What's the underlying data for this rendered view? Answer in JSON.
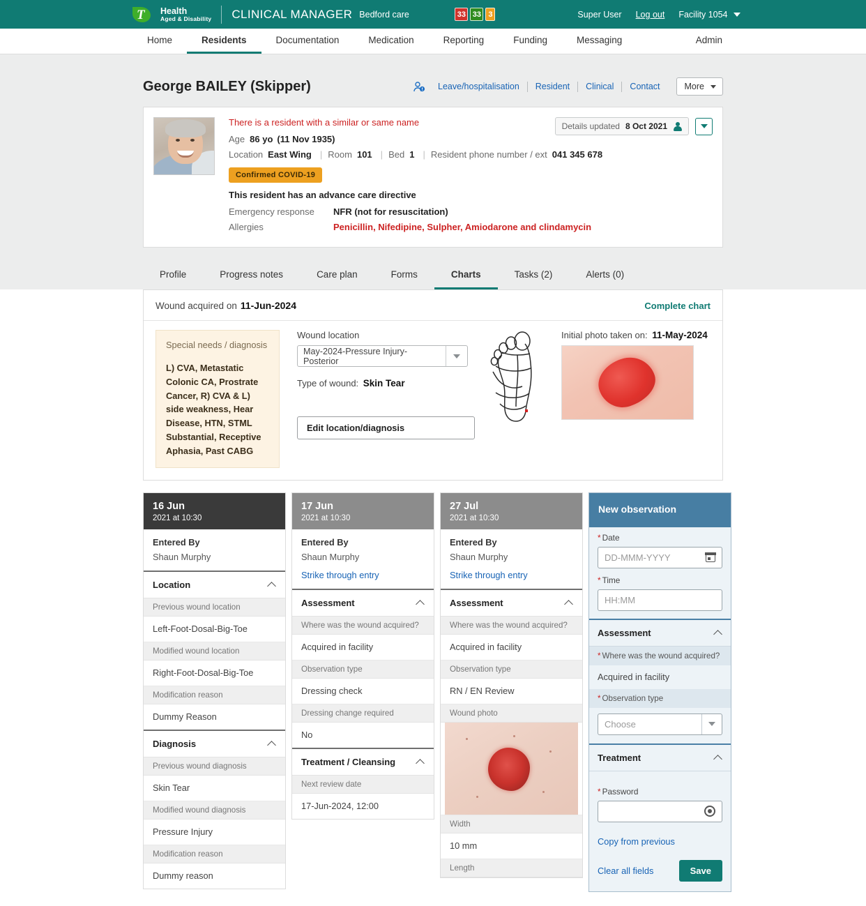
{
  "topbar": {
    "brand_line1": "Health",
    "brand_line2": "Aged & Disability",
    "app_title": "CLINICAL MANAGER",
    "facility_name": "Bedford care",
    "badges": [
      {
        "value": "33",
        "color": "#d0342c",
        "name": "alerts-red"
      },
      {
        "value": "33",
        "color": "#2f8c1f",
        "name": "alerts-green"
      },
      {
        "value": "3",
        "color": "#eda020",
        "name": "alerts-orange"
      }
    ],
    "user": "Super User",
    "logout": "Log out",
    "facility_selector": "Facility 1054"
  },
  "nav": {
    "items": [
      "Home",
      "Residents",
      "Documentation",
      "Medication",
      "Reporting",
      "Funding",
      "Messaging"
    ],
    "active": "Residents",
    "admin": "Admin"
  },
  "resident": {
    "name": "George BAILEY (Skipper)",
    "actions": [
      "Leave/hospitalisation",
      "Resident",
      "Clinical",
      "Contact"
    ],
    "more_label": "More",
    "similar_name_warning": "There is a resident with a similar or same name",
    "age_label": "Age",
    "age_value": "86 yo",
    "dob": "(11 Nov 1935)",
    "location_label": "Location",
    "location_value": "East Wing",
    "room_label": "Room",
    "room_value": "101",
    "bed_label": "Bed",
    "bed_value": "1",
    "phone_label": "Resident phone number / ext",
    "phone_value": "041 345 678",
    "covid_tag": "Confirmed COVID-19",
    "advance_care": "This resident has an advance care directive",
    "emergency_label": "Emergency response",
    "emergency_value": "NFR (not for resuscitation)",
    "allergies_label": "Allergies",
    "allergies_value": "Penicillin, Nifedipine, Sulpher, Amiodarone and clindamycin",
    "updated_label": "Details updated",
    "updated_date": "8 Oct 2021"
  },
  "subtabs": {
    "items": [
      "Profile",
      "Progress notes",
      "Care plan",
      "Forms",
      "Charts",
      "Tasks (2)",
      "Alerts (0)"
    ],
    "active": "Charts"
  },
  "wound": {
    "acquired_label": "Wound acquired on",
    "acquired_date": "11-Jun-2024",
    "complete_chart": "Complete chart",
    "special_needs_label": "Special needs / diagnosis",
    "special_needs_value": "L) CVA, Metastatic Colonic CA, Prostrate Cancer, R) CVA & L) side weakness, Hear Disease, HTN, STML Substantial, Receptive Aphasia, Past CABG",
    "location_label": "Wound location",
    "location_value": "May-2024-Pressure Injury-Posterior",
    "type_label": "Type of wound:",
    "type_value": "Skin Tear",
    "edit_button": "Edit location/diagnosis",
    "initial_photo_label": "Initial photo taken on:",
    "initial_photo_date": "11-May-2024"
  },
  "observations": [
    {
      "date": "16 Jun",
      "time": "2021 at 10:30",
      "header_style": "dark",
      "entered_by_label": "Entered By",
      "entered_by_value": "Shaun Murphy",
      "strike_link": null,
      "sections": [
        {
          "title": "Location",
          "fields": [
            {
              "key": "Previous wound location",
              "value": "Left-Foot-Dosal-Big-Toe"
            },
            {
              "key": "Modified wound location",
              "value": "Right-Foot-Dosal-Big-Toe"
            },
            {
              "key": "Modification reason",
              "value": "Dummy Reason"
            }
          ]
        },
        {
          "title": "Diagnosis",
          "fields": [
            {
              "key": "Previous wound diagnosis",
              "value": "Skin Tear"
            },
            {
              "key": "Modified wound diagnosis",
              "value": "Pressure Injury"
            },
            {
              "key": "Modification reason",
              "value": "Dummy reason"
            }
          ]
        }
      ]
    },
    {
      "date": "17 Jun",
      "time": "2021 at 10:30",
      "header_style": "grey",
      "entered_by_label": "Entered By",
      "entered_by_value": "Shaun Murphy",
      "strike_link": "Strike through entry",
      "sections": [
        {
          "title": "Assessment",
          "fields": [
            {
              "key": "Where was the wound acquired?",
              "value": "Acquired in facility"
            },
            {
              "key": "Observation type",
              "value": "Dressing check"
            },
            {
              "key": "Dressing change required",
              "value": "No"
            }
          ]
        },
        {
          "title": "Treatment / Cleansing",
          "fields": [
            {
              "key": "Next review date",
              "value": "17-Jun-2024, 12:00"
            }
          ]
        }
      ]
    },
    {
      "date": "27 Jul",
      "time": "2021 at 10:30",
      "header_style": "grey",
      "entered_by_label": "Entered By",
      "entered_by_value": "Shaun Murphy",
      "strike_link": "Strike through entry",
      "sections": [
        {
          "title": "Assessment",
          "fields": [
            {
              "key": "Where was the wound acquired?",
              "value": "Acquired in facility"
            },
            {
              "key": "Observation type",
              "value": "RN / EN Review"
            },
            {
              "key": "Wound photo",
              "value": "__PHOTO__"
            },
            {
              "key": "Width",
              "value": "10 mm"
            },
            {
              "key": "Length",
              "value": ""
            }
          ]
        }
      ]
    }
  ],
  "new_observation": {
    "title": "New observation",
    "date_label": "Date",
    "date_placeholder": "DD-MMM-YYYY",
    "time_label": "Time",
    "time_placeholder": "HH:MM",
    "assessment_title": "Assessment",
    "acquired_label": "Where was the wound acquired?",
    "acquired_value": "Acquired in facility",
    "obs_type_label": "Observation type",
    "obs_type_placeholder": "Choose",
    "treatment_title": "Treatment",
    "password_label": "Password",
    "copy_link": "Copy from previous",
    "clear_link": "Clear all fields",
    "save_label": "Save"
  },
  "colors": {
    "brand_teal": "#107b73",
    "accent_green": "#3fae2a",
    "link_blue": "#1763b5",
    "warn_red": "#cc2222",
    "covid_orange": "#eda020",
    "panel_blue": "#477ea3"
  }
}
